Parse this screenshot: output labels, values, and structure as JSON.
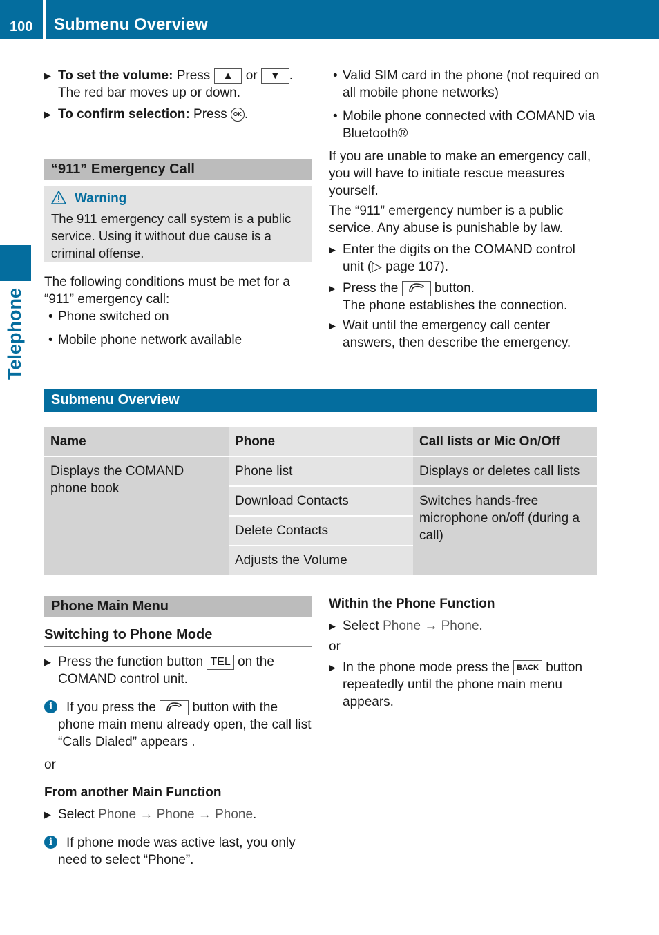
{
  "header": {
    "page_number": "100",
    "title": "Submenu Overview"
  },
  "side_tab": {
    "label": "Telephone"
  },
  "volume_steps": {
    "set_volume_label": "To set the volume:",
    "set_volume_text": "Press",
    "up_key": "▲",
    "or": "or",
    "down_key": "▼",
    "set_volume_result": "The red bar moves up or down.",
    "confirm_label": "To confirm selection:",
    "confirm_text": "Press",
    "ok_key": "OK"
  },
  "emergency": {
    "title": "“911” Emergency Call",
    "warning_title": "Warning",
    "warning_text": "The 911 emergency call system is a public service. Using it without due cause is a criminal offense.",
    "conditions_intro": "The following conditions must be met for a “911” emergency call:",
    "conditions": [
      "Phone switched on",
      "Mobile phone network available",
      "Valid SIM card in the phone (not required on all mobile phone networks)",
      "Mobile phone connected with COMAND via Bluetooth®"
    ],
    "para_unable": "If you are unable to make an emergency call, you will have to initiate rescue measures yourself.",
    "para_public": "The “911” emergency number is a public service. Any abuse is punishable by law.",
    "step_enter": "Enter the digits on the COMAND control unit (▷ page 107).",
    "step_press_pre": "Press the",
    "step_press_post": "button.",
    "step_press_result": "The phone establishes the connection.",
    "step_wait": "Wait until the emergency call center answers, then describe the emergency."
  },
  "submenu": {
    "title": "Submenu Overview",
    "headers": [
      "Name",
      "Phone",
      "Call lists or Mic On/Off"
    ],
    "name_cell": "Displays the COMAND phone book",
    "phone_items": [
      "Phone list",
      "Download Contacts",
      "Delete Contacts",
      "Adjusts the Volume"
    ],
    "call_lists": "Displays or deletes call lists",
    "mic": "Switches hands-free microphone on/off (during a call)"
  },
  "phone_menu": {
    "title": "Phone Main Menu",
    "switching_heading": "Switching to Phone Mode",
    "press_pre": "Press the function button",
    "tel_key": "TEL",
    "press_post": "on the COMAND control unit.",
    "info1_pre": "If you press the",
    "info1_post": "button with the phone main menu already open, the call list “Calls Dialed” appears .",
    "or": "or",
    "from_heading": "From another Main Function",
    "select_word": "Select",
    "from_path": "Phone → Phone → Phone",
    "info2": "If phone mode was active last, you only need to select “Phone”.",
    "within_heading": "Within the Phone Function",
    "within_path": "Phone → Phone",
    "back_pre": "In the phone mode press the",
    "back_key": "BACK",
    "back_post": "button repeatedly until the phone main menu appears."
  }
}
